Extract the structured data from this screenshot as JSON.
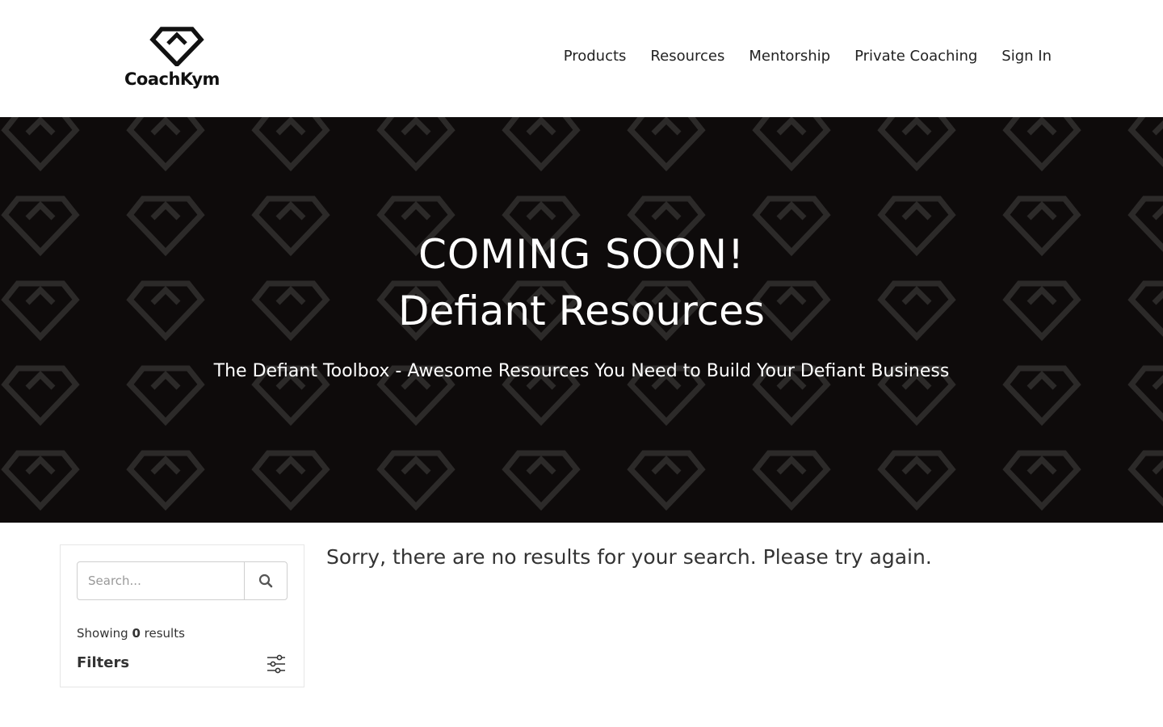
{
  "header": {
    "logo_text": "CoachKym",
    "nav": [
      {
        "label": "Products"
      },
      {
        "label": "Resources"
      },
      {
        "label": "Mentorship"
      },
      {
        "label": "Private Coaching"
      },
      {
        "label": "Sign In"
      }
    ]
  },
  "hero": {
    "title_line1": "COMING SOON!",
    "title_line2": "Defiant Resources",
    "subtitle": "The Defiant Toolbox - Awesome Resources You Need to Build Your Defiant Business",
    "background_color": "#0e0b0b",
    "pattern_color": "#2c2a29",
    "pattern_icon": "diamond-icon"
  },
  "sidebar": {
    "search": {
      "placeholder": "Search...",
      "value": "",
      "button_icon": "search-icon"
    },
    "showing_prefix": "Showing",
    "result_count": "0",
    "showing_suffix": "results",
    "filters_label": "Filters",
    "filters_icon": "sliders-icon"
  },
  "main": {
    "no_results_message": "Sorry, there are no results for your search. Please try again."
  },
  "colors": {
    "text": "#222222",
    "border": "#e6e6e6"
  }
}
